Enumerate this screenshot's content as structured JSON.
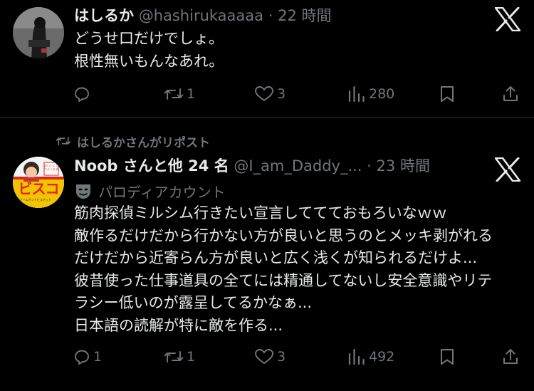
{
  "tweet1": {
    "display_name": "はしるか",
    "handle": "@hashirukaaaaa",
    "separator": "·",
    "time": "22 時間",
    "lines": [
      "どうせ口だけでしょ。",
      "根性無いもんなあれ。"
    ],
    "actions": {
      "replies": "",
      "reposts": "1",
      "likes": "3",
      "views": "280"
    }
  },
  "repost_banner": {
    "text": "はしるかさんがリポスト"
  },
  "tweet2": {
    "display_name": "Noob さんと他 24 名",
    "handle": "@I_am_Daddy_...",
    "separator": "·",
    "time": "23 時間",
    "parody_label": "パロディアカウント",
    "avatar_text": {
      "main": "ビスコ",
      "small_top": "おいしくてつよくなる",
      "small_bottom": "クリームサンドビスケット"
    },
    "lines": [
      "筋肉探偵ミルシム行きたい宣言しててておもろいなｗｗ",
      "敵作るだけだから行かない方が良いと思うのとメッキ剥がれる",
      "だけだから近寄らん方が良いと広く浅くが知られるだけよ...",
      "彼昔使った仕事道具の全てには精通してないし安全意識やリテ",
      "ラシー低いのが露呈してるかなぁ...",
      "日本語の読解が特に敵を作る..."
    ],
    "actions": {
      "replies": "1",
      "reposts": "1",
      "likes": "3",
      "views": "492"
    }
  },
  "colors": {
    "background": "#000000",
    "text": "#e7e9ea",
    "muted": "#71767b",
    "divider": "#2f3336"
  },
  "icons": [
    "x-logo-icon",
    "reply-icon",
    "repost-icon",
    "like-icon",
    "views-icon",
    "bookmark-icon",
    "share-icon",
    "theater-mask-icon"
  ]
}
